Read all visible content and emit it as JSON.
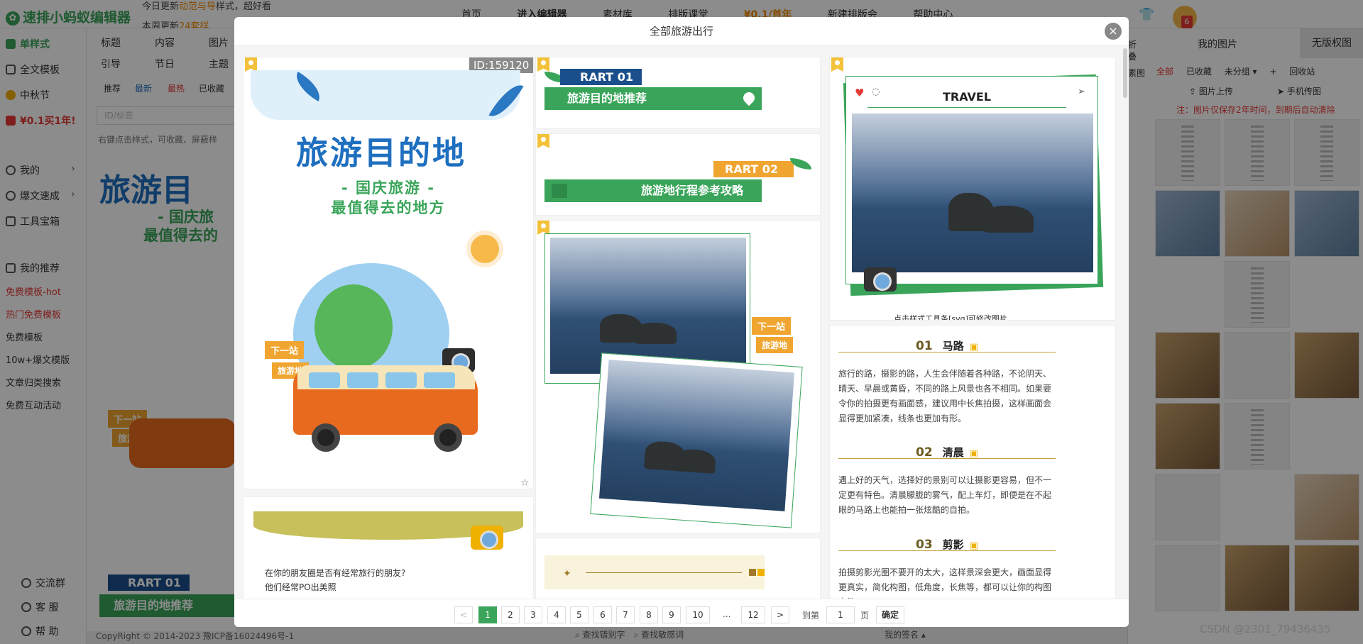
{
  "app": {
    "logo": "速排小蚂蚁编辑器",
    "notice1_a": "今日更新",
    "notice1_em": "动范与导",
    "notice1_b": "样式，超好看",
    "notice2_a": "本周更新",
    "notice2_em": "24套样",
    "nav": [
      "首页",
      "进入编辑器",
      "素材库",
      "排版课堂",
      "¥0.1/首年",
      "新建排版会",
      "帮助中心"
    ],
    "badge": "6"
  },
  "sidebar": {
    "items": [
      {
        "label": "单样式"
      },
      {
        "label": "全文模板"
      },
      {
        "label": "中秋节"
      },
      {
        "label": "¥0.1买1年!"
      },
      {
        "label": "我的"
      },
      {
        "label": "爆文速成"
      },
      {
        "label": "工具宝箱"
      },
      {
        "label": "我的推荐"
      }
    ],
    "links": [
      "免费模板-hot",
      "热门免费模板",
      "免费模板",
      "10w+爆文模版",
      "文章归类搜索",
      "免费互动活动"
    ],
    "bottom": [
      "交流群",
      "客 服",
      "帮 助"
    ]
  },
  "categories": {
    "row1": [
      "标题",
      "内容",
      "图片"
    ],
    "row2": [
      "引导",
      "节日",
      "主题"
    ],
    "tabs": [
      "推荐",
      "最新",
      "最热",
      "已收藏"
    ],
    "search_placeholder": "ID/标签",
    "hint": "右键点击样式，可收藏、屏蔽样"
  },
  "right_panel": {
    "side_tab": "折叠",
    "title": "我的图片",
    "title2": "无版权图",
    "side2": "素图",
    "tabs": [
      "全部",
      "已收藏",
      "未分组 ▾",
      "+",
      "回收站"
    ],
    "upload": "图片上传",
    "phone": "手机传图",
    "warn": "注：图片仅保存2年时间，到期后自动清除"
  },
  "modal": {
    "title": "全部旅游出行",
    "close": "×",
    "card1": {
      "id": "ID:159120",
      "title": "旅游目的地",
      "sub1": "- 国庆旅游 -",
      "sub2": "最值得去的地方",
      "sign1": "下一站",
      "sign2": "旅游地"
    },
    "card2": {
      "title": "在你的朋友圈是否有经常旅行的朋友?",
      "title2": "他们经常PO出美照"
    },
    "rart1": {
      "label": "RART 01",
      "bar": "旅游目的地推荐"
    },
    "rart2": {
      "label": "RART 02",
      "bar": "旅游地行程参考攻略"
    },
    "photo_card": {
      "sign1": "下一站",
      "sign2": "旅游地"
    },
    "travel": {
      "title": "TRAVEL",
      "caption": "点击样式工具条[svg]可修改图片"
    },
    "sections": [
      {
        "n": "01",
        "t": "马路",
        "p": "旅行的路，摄影的路，人生会伴随着各种路，不论阴天、晴天、早晨或黄昏，不同的路上风景也各不相同。如果要令你的拍摄更有画面感，建议用中长焦拍摄，这样画面会显得更加紧凑，线条也更加有形。"
      },
      {
        "n": "02",
        "t": "清晨",
        "p": "遇上好的天气，选择好的景别可以让摄影更容易，但不一定更有特色。清晨朦胧的雾气，配上车灯，即便是在不起眼的马路上也能拍一张炫酷的自拍。"
      },
      {
        "n": "03",
        "t": "剪影",
        "p": "拍摄剪影光圈不要开的太大，这样景深会更大，画面显得更真实，简化构图，低角度，长焦等，都可以让你的构图变简"
      }
    ],
    "pager": {
      "pages": [
        "1",
        "2",
        "3",
        "4",
        "5",
        "6",
        "7",
        "8",
        "9",
        "10",
        "...",
        "12"
      ],
      "prev": "<",
      "next": ">",
      "goto": "到第",
      "page_val": "1",
      "page_unit": "页",
      "confirm": "确定"
    }
  },
  "left_preview": {
    "title": "旅游目",
    "sub1": "- 国庆旅",
    "sub2": "最值得去的",
    "rart": "RART 01",
    "bar": "旅游目的地推荐",
    "sign1": "下一站",
    "sign2": "旅游地"
  },
  "footer": {
    "copyright": "CopyRight © 2014-2023 豫ICP备16024496号-1",
    "find1": "查找错别字",
    "find2": "查找敏感词",
    "sign": "我的签名 ▴",
    "watermark": "CSDN @2301_79436435"
  }
}
